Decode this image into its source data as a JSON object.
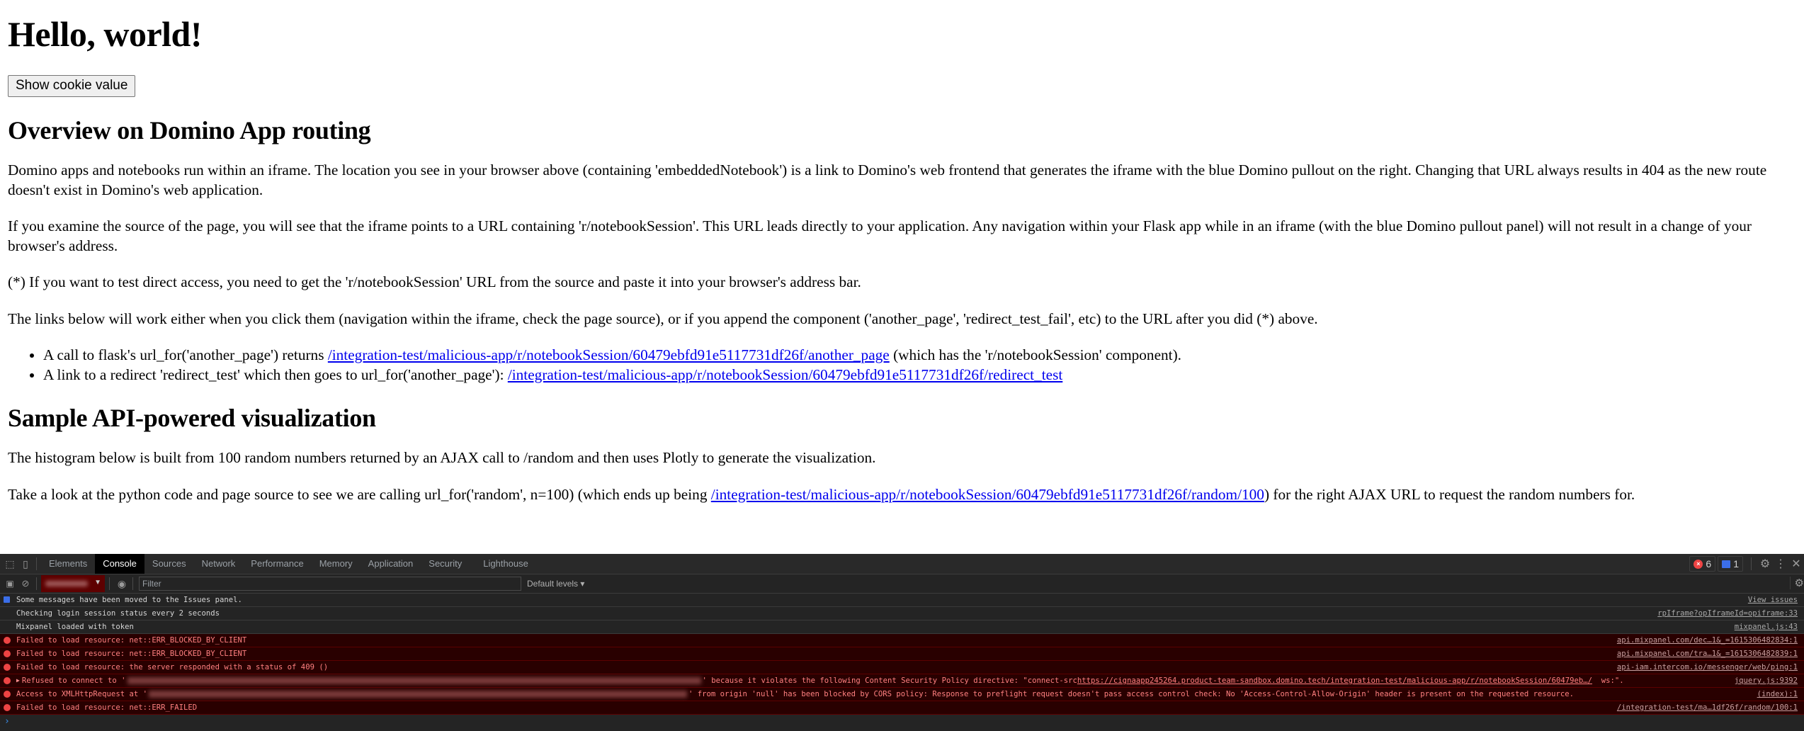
{
  "page": {
    "title": "Hello, world!",
    "cookie_button": "Show cookie value",
    "section1_heading": "Overview on Domino App routing",
    "p1": "Domino apps and notebooks run within an iframe. The location you see in your browser above (containing 'embeddedNotebook') is a link to Domino's web frontend that generates the iframe with the blue Domino pullout on the right. Changing that URL always results in 404 as the new route doesn't exist in Domino's web application.",
    "p2": "If you examine the source of the page, you will see that the iframe points to a URL containing 'r/notebookSession'. This URL leads directly to your application. Any navigation within your Flask app while in an iframe (with the blue Domino pullout panel) will not result in a change of your browser's address.",
    "p3": "(*) If you want to test direct access, you need to get the 'r/notebookSession' URL from the source and paste it into your browser's address bar.",
    "p4": "The links below will work either when you click them (navigation within the iframe, check the page source), or if you append the component ('another_page', 'redirect_test_fail', etc) to the URL after you did (*) above.",
    "list": [
      {
        "before": "A call to flask's url_for('another_page') returns ",
        "link": "/integration-test/malicious-app/r/notebookSession/60479ebfd91e5117731df26f/another_page",
        "after": " (which has the 'r/notebookSession' component)."
      },
      {
        "before": "A link to a redirect 'redirect_test' which then goes to url_for('another_page'): ",
        "link": "/integration-test/malicious-app/r/notebookSession/60479ebfd91e5117731df26f/redirect_test",
        "after": ""
      }
    ],
    "section2_heading": "Sample API-powered visualization",
    "p5": "The histogram below is built from 100 random numbers returned by an AJAX call to /random and then uses Plotly to generate the visualization.",
    "p6_before": "Take a look at the python code and page source to see we are calling url_for('random', n=100) (which ends up being ",
    "p6_link": "/integration-test/malicious-app/r/notebookSession/60479ebfd91e5117731df26f/random/100",
    "p6_after": ") for the right AJAX URL to request the random numbers for."
  },
  "devtools": {
    "tabs": [
      "Elements",
      "Console",
      "Sources",
      "Network",
      "Performance",
      "Memory",
      "Application",
      "Security",
      "Lighthouse"
    ],
    "active_tab": "Console",
    "error_count": "6",
    "message_count": "1",
    "filter_placeholder": "Filter",
    "levels_label": "Default levels ▾",
    "colors": {
      "error_bg": "#290000",
      "error_text": "#ff8080",
      "accent": "#3b6ee8"
    },
    "rows": [
      {
        "type": "info",
        "text": "Some messages have been moved to the Issues panel.",
        "source": "View issues"
      },
      {
        "type": "log",
        "text": "Checking login session status every 2 seconds",
        "source": "rpIframe?opIframeId=opiframe:33"
      },
      {
        "type": "log",
        "text": "Mixpanel loaded with token",
        "source": "mixpanel.js:43"
      },
      {
        "type": "error",
        "text": "Failed to load resource: net::ERR_BLOCKED_BY_CLIENT",
        "source": "api.mixpanel.com/dec…1&_=1615306482834:1"
      },
      {
        "type": "error",
        "text": "Failed to load resource: net::ERR_BLOCKED_BY_CLIENT",
        "source": "api.mixpanel.com/tra…1&_=1615306482839:1"
      },
      {
        "type": "error",
        "text": "Failed to load resource: the server responded with a status of 409 ()",
        "source": "api-iam.intercom.io/messenger/web/ping:1"
      },
      {
        "type": "error",
        "text_before": "Refused to connect to '",
        "text_after": "' because it violates the following Content Security Policy directive: \"connect-src ",
        "link": "https://cignaapp245264.product-team-sandbox.domino.tech/integration-test/malicious-app/r/notebookSession/60479eb…/",
        "text_end": "  ws:\".",
        "source": "jquery.js:9392"
      },
      {
        "type": "error",
        "text_before": "Access to XMLHttpRequest at '",
        "text_after": "' from origin 'null' has been blocked by CORS policy: Response to preflight request doesn't pass access control check: No 'Access-Control-Allow-Origin' header is present on the requested resource.",
        "source": "(index):1"
      },
      {
        "type": "error",
        "text": "Failed to load resource: net::ERR_FAILED",
        "source": "/integration-test/ma…1df26f/random/100:1"
      }
    ],
    "prompt": "›"
  }
}
